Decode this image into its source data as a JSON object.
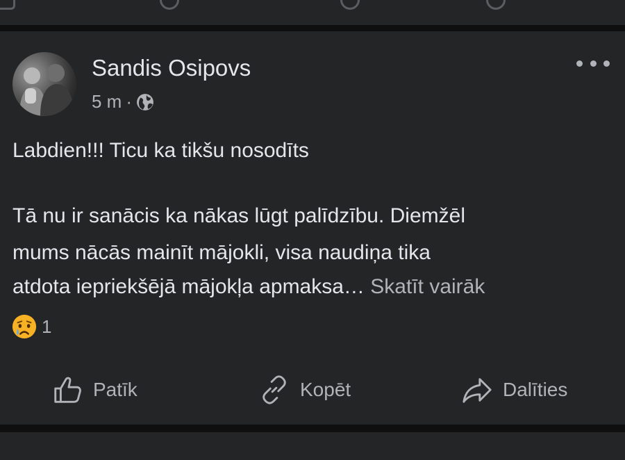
{
  "post": {
    "author": "Sandis Osipovs",
    "time": "5 m",
    "separator": "·",
    "privacy_icon": "globe-icon",
    "text": {
      "line1": "Labdien!!! Ticu ka tikšu nosodīts",
      "line2": "Tā nu ir sanācis ka nākas lūgt palīdzību. Diemžēl",
      "line3": "mums nācās mainīt mājokli, visa naudiņa tika",
      "line4": "atdota iepriekšējā mājokļa apmaksa…",
      "see_more": "Skatīt vairāk"
    },
    "reactions": {
      "icon": "crying-face-icon",
      "count": "1"
    },
    "actions": {
      "like": "Patīk",
      "copy": "Kopēt",
      "share": "Dalīties"
    }
  },
  "colors": {
    "background": "#0f0f10",
    "card": "#242526",
    "text_primary": "#e4e6eb",
    "text_secondary": "#b0b3b8",
    "emoji_yellow": "#f7b125"
  }
}
